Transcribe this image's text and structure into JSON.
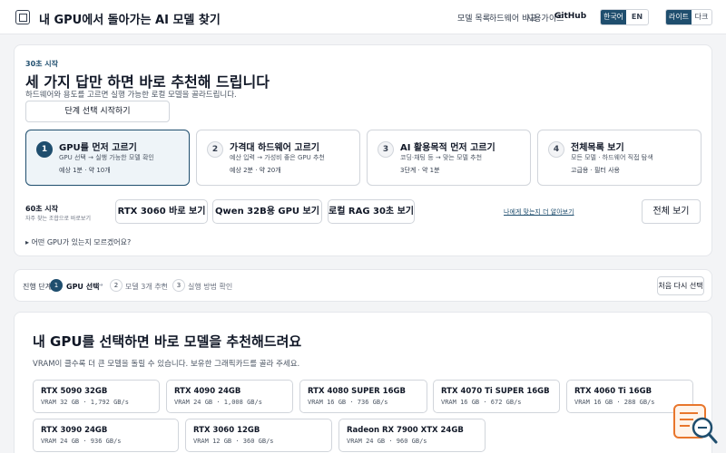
{
  "header": {
    "brand": "내 GPU에서 돌아가는 AI 모델 찾기",
    "nav": [
      "모델 목록",
      "하드웨어 비교",
      "사용가이드",
      "GitHub"
    ],
    "lang": {
      "active": "한국어",
      "other": "EN"
    },
    "theme": {
      "active": "라이트",
      "other": "다크"
    }
  },
  "hero": {
    "eyebrow": "30초 시작",
    "title": "세 가지 답만 하면 바로 추천해 드립니다",
    "subtitle": "하드웨어와 용도를 고르면 실행 가능한 로컬 모델을 골라드립니다.",
    "start_button": "단계 선택 시작하기",
    "steps": [
      {
        "num": "1",
        "title": "GPU를 먼저 고르기",
        "desc": "GPU 선택 → 실행 가능한 모델 확인",
        "meta": "예상 1분 · 약 10개",
        "active": true
      },
      {
        "num": "2",
        "title": "가격대 하드웨어 고르기",
        "desc": "예산 입력 → 가성비 좋은 GPU 추천",
        "meta": "예상 2분 · 약 20개",
        "active": false
      },
      {
        "num": "3",
        "title": "AI 활용목적 먼저 고르기",
        "desc": "코딩·채팅 등 → 맞는 모델 추천",
        "meta": "3단계 · 약 1분",
        "active": false
      },
      {
        "num": "4",
        "title": "전체목록 보기",
        "desc": "모든 모델 · 하드웨어 직접 탐색",
        "meta": "고급용 · 필터 사용",
        "active": false
      }
    ],
    "quick": {
      "label": "60초 시작",
      "sub": "자주 찾는 조합으로 바로보기",
      "chips": [
        "RTX 3060 바로 보기",
        "Qwen 32B용 GPU 보기",
        "로컬 RAG 30초 보기"
      ],
      "link": "나에게 맞는지 더 알아보기",
      "more_button": "전체 보기"
    },
    "details": "▸ 어떤 GPU가 있는지 모르겠어요?"
  },
  "breadcrumb": {
    "label": "진행 단계",
    "steps": [
      {
        "num": "1",
        "text": "GPU 선택",
        "active": true
      },
      {
        "num": "2",
        "text": "모델 3개 추천",
        "active": false
      },
      {
        "num": "3",
        "text": "실행 방법 확인",
        "active": false
      }
    ],
    "reset_button": "처음 다시 선택"
  },
  "gpu_section": {
    "title": "내 GPU를 선택하면 바로 모델을 추천해드려요",
    "subtitle": "VRAM이 클수록 더 큰 모델을 돌릴 수 있습니다. 보유한 그래픽카드를 골라 주세요.",
    "gpus": [
      {
        "name": "RTX 5090 32GB",
        "spec": "VRAM 32 GB · 1,792 GB/s"
      },
      {
        "name": "RTX 4090 24GB",
        "spec": "VRAM 24 GB · 1,008 GB/s"
      },
      {
        "name": "RTX 4080 SUPER 16GB",
        "spec": "VRAM 16 GB · 736 GB/s"
      },
      {
        "name": "RTX 4070 Ti SUPER 16GB",
        "spec": "VRAM 16 GB · 672 GB/s"
      },
      {
        "name": "RTX 4060 Ti 16GB",
        "spec": "VRAM 16 GB · 288 GB/s"
      },
      {
        "name": "RTX 3090 24GB",
        "spec": "VRAM 24 GB · 936 GB/s"
      },
      {
        "name": "RTX 3060 12GB",
        "spec": "VRAM 12 GB · 360 GB/s"
      },
      {
        "name": "Radeon RX 7900 XTX 24GB",
        "spec": "VRAM 24 GB · 960 GB/s"
      }
    ]
  },
  "colors": {
    "accent": "#1f4e6e",
    "fab": "#e8762c"
  }
}
